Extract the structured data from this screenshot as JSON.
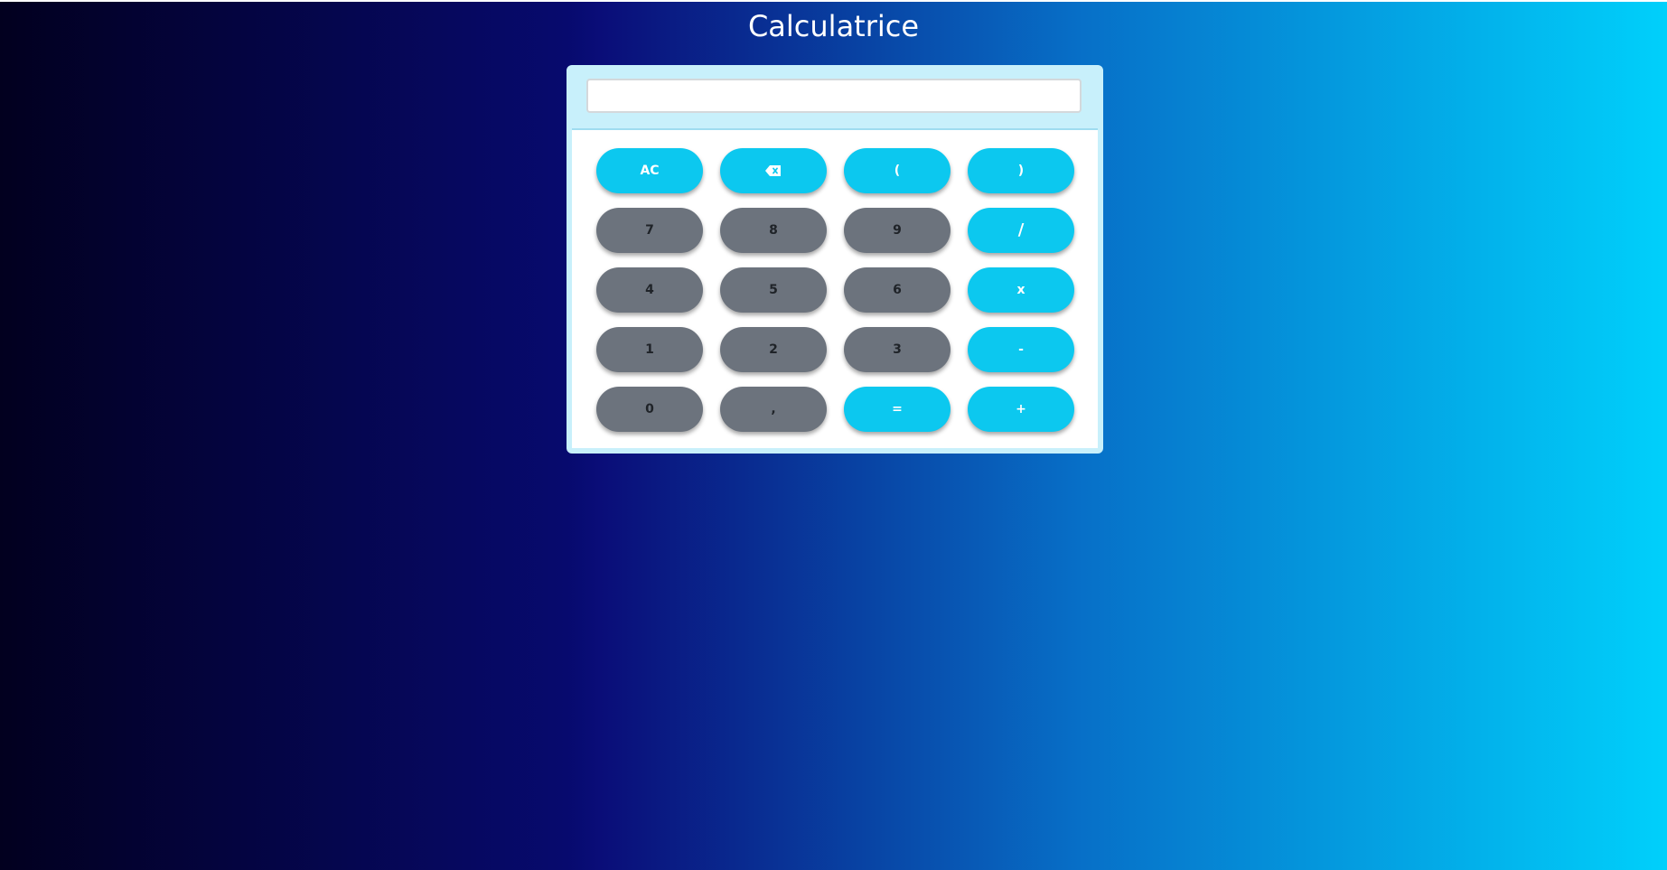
{
  "page": {
    "title": "Calculatrice"
  },
  "display": {
    "value": "",
    "placeholder": ""
  },
  "keys": {
    "ac": "AC",
    "backspace_icon": "backspace-icon",
    "open_paren": "(",
    "close_paren": ")",
    "seven": "7",
    "eight": "8",
    "nine": "9",
    "divide": "/",
    "four": "4",
    "five": "5",
    "six": "6",
    "multiply": "x",
    "one": "1",
    "two": "2",
    "three": "3",
    "minus": "-",
    "zero": "0",
    "comma": ",",
    "equals": "=",
    "plus": "+"
  },
  "colors": {
    "operator_key": "#0cc8ef",
    "number_key": "#6c737d",
    "display_panel": "#c8f0fb"
  }
}
